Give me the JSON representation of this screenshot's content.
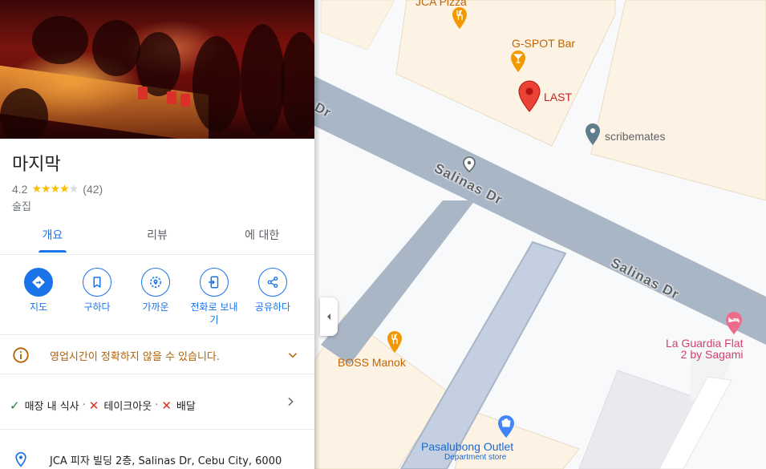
{
  "place": {
    "name": "마지막",
    "rating": "4.2",
    "review_count": "(42)",
    "category": "술집"
  },
  "tabs": [
    {
      "label": "개요",
      "active": true
    },
    {
      "label": "리뷰",
      "active": false
    },
    {
      "label": "에 대한",
      "active": false
    }
  ],
  "actions": [
    {
      "label": "지도",
      "icon": "directions-icon"
    },
    {
      "label": "구하다",
      "icon": "bookmark-icon"
    },
    {
      "label": "가까운",
      "icon": "nearby-icon"
    },
    {
      "label": "전화로 보내기",
      "icon": "send-to-phone-icon"
    },
    {
      "label": "공유하다",
      "icon": "share-icon"
    }
  ],
  "notice": {
    "text": "영업시간이 정확하지 않을 수 있습니다."
  },
  "services": [
    {
      "label": "매장 내 식사",
      "available": true,
      "sep": "·"
    },
    {
      "label": "테이크아웃",
      "available": false,
      "sep": "·"
    },
    {
      "label": "배달",
      "available": false,
      "sep": ""
    }
  ],
  "address": {
    "text": "JCA 피자 빌딩 2층, Salinas Dr, Cebu City, 6000"
  },
  "map": {
    "places": {
      "jca_pizza": "JCA Pizza",
      "gspot_bar": "G-SPOT Bar",
      "last": "LAST",
      "scribemates": "scribemates",
      "boss_manok": "BOSS Manok",
      "la_guardia_line1": "La Guardia Flat",
      "la_guardia_line2": "2 by Sagami",
      "pasalubong": "Pasalubong Outlet",
      "pasalubong_sub": "Department store"
    },
    "roads": {
      "salinas_1": "Salinas Dr",
      "salinas_2": "Salinas Dr",
      "dr_fragment": "Dr"
    }
  },
  "colors": {
    "accent": "#1a73e8",
    "warning": "#b06000",
    "pin_red": "#ea4335",
    "food_pin": "#f29900",
    "hotel_pin": "#ee6b8b",
    "shop_pin": "#4285f4"
  }
}
